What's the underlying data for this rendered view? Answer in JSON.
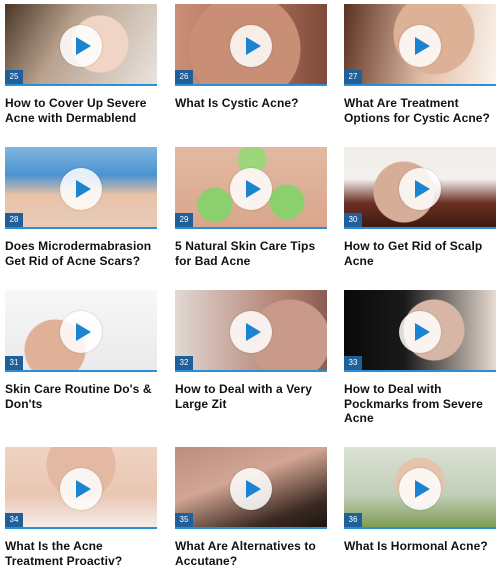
{
  "accent_color": "#2a8fd6",
  "play_icon": "play-icon",
  "cards": [
    {
      "num": "25",
      "title": "How to Cover Up Severe Acne with Dermablend"
    },
    {
      "num": "26",
      "title": "What Is Cystic Acne?"
    },
    {
      "num": "27",
      "title": "What Are Treatment Options for Cystic Acne?"
    },
    {
      "num": "28",
      "title": "Does Microdermabrasion Get Rid of Acne Scars?"
    },
    {
      "num": "29",
      "title": "5 Natural Skin Care Tips for Bad Acne"
    },
    {
      "num": "30",
      "title": "How to Get Rid of Scalp Acne"
    },
    {
      "num": "31",
      "title": "Skin Care Routine Do's & Don'ts"
    },
    {
      "num": "32",
      "title": "How to Deal with a Very Large Zit"
    },
    {
      "num": "33",
      "title": "How to Deal with Pockmarks from Severe Acne"
    },
    {
      "num": "34",
      "title": "What Is the Acne Treatment Proactiv?"
    },
    {
      "num": "35",
      "title": "What Are Alternatives to Accutane?"
    },
    {
      "num": "36",
      "title": "What Is Hormonal Acne?"
    }
  ]
}
